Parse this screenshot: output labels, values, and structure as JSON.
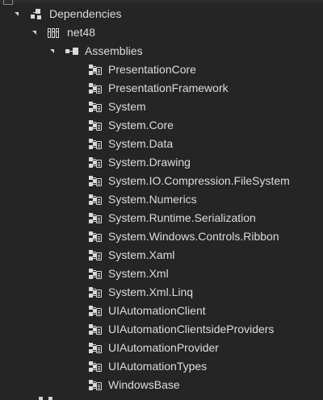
{
  "tree": {
    "dependencies_label": "Dependencies",
    "framework_label": "net48",
    "assemblies_label": "Assemblies",
    "assemblies": [
      "PresentationCore",
      "PresentationFramework",
      "System",
      "System.Core",
      "System.Data",
      "System.Drawing",
      "System.IO.Compression.FileSystem",
      "System.Numerics",
      "System.Runtime.Serialization",
      "System.Windows.Controls.Ribbon",
      "System.Xaml",
      "System.Xml",
      "System.Xml.Linq",
      "UIAutomationClient",
      "UIAutomationClientsideProviders",
      "UIAutomationProvider",
      "UIAutomationTypes",
      "WindowsBase"
    ]
  },
  "icons": {
    "dependencies": "dependencies-icon",
    "framework": "framework-icon",
    "assemblies_folder": "assemblies-icon",
    "assembly_reference": "assembly-reference-icon",
    "expanded": "expanded-arrow-icon"
  },
  "colors": {
    "background": "#252526",
    "text": "#dcdcdc"
  }
}
